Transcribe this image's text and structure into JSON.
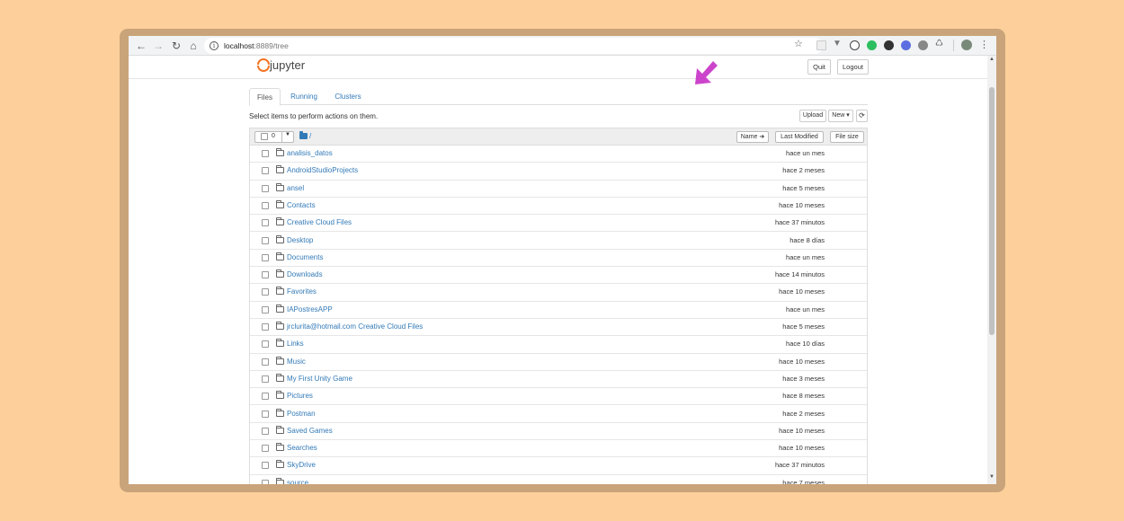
{
  "browser": {
    "url_host": "localhost",
    "url_path": ":8889/tree"
  },
  "header": {
    "logo_text": "jupyter",
    "quit_label": "Quit",
    "logout_label": "Logout"
  },
  "tabs": [
    {
      "label": "Files"
    },
    {
      "label": "Running"
    },
    {
      "label": "Clusters"
    }
  ],
  "toolbar": {
    "instructions": "Select items to perform actions on them.",
    "upload_label": "Upload",
    "new_label": "New ▾",
    "refresh_icon": "refresh-icon"
  },
  "list_header": {
    "selected_count": "0",
    "path": "/",
    "name_label": "Name ➜",
    "last_modified_label": "Last Modified",
    "file_size_label": "File size"
  },
  "items": [
    {
      "name": "analisis_datos",
      "modified": "hace un mes"
    },
    {
      "name": "AndroidStudioProjects",
      "modified": "hace 2 meses"
    },
    {
      "name": "ansel",
      "modified": "hace 5 meses"
    },
    {
      "name": "Contacts",
      "modified": "hace 10 meses"
    },
    {
      "name": "Creative Cloud Files",
      "modified": "hace 37 minutos"
    },
    {
      "name": "Desktop",
      "modified": "hace 8 días"
    },
    {
      "name": "Documents",
      "modified": "hace un mes"
    },
    {
      "name": "Downloads",
      "modified": "hace 14 minutos"
    },
    {
      "name": "Favorites",
      "modified": "hace 10 meses"
    },
    {
      "name": "IAPostresAPP",
      "modified": "hace un mes"
    },
    {
      "name": "jrclurita@hotmail.com Creative Cloud Files",
      "modified": "hace 5 meses"
    },
    {
      "name": "Links",
      "modified": "hace 10 días"
    },
    {
      "name": "Music",
      "modified": "hace 10 meses"
    },
    {
      "name": "My First Unity Game",
      "modified": "hace 3 meses"
    },
    {
      "name": "Pictures",
      "modified": "hace 8 meses"
    },
    {
      "name": "Postman",
      "modified": "hace 2 meses"
    },
    {
      "name": "Saved Games",
      "modified": "hace 10 meses"
    },
    {
      "name": "Searches",
      "modified": "hace 10 meses"
    },
    {
      "name": "SkyDrive",
      "modified": "hace 37 minutos"
    },
    {
      "name": "source",
      "modified": "hace 7 meses"
    }
  ],
  "colors": {
    "background": "#fdd09b",
    "link": "#337ab7",
    "jupyter_orange": "#f37626",
    "annotation_arrow": "#cc44cc"
  }
}
